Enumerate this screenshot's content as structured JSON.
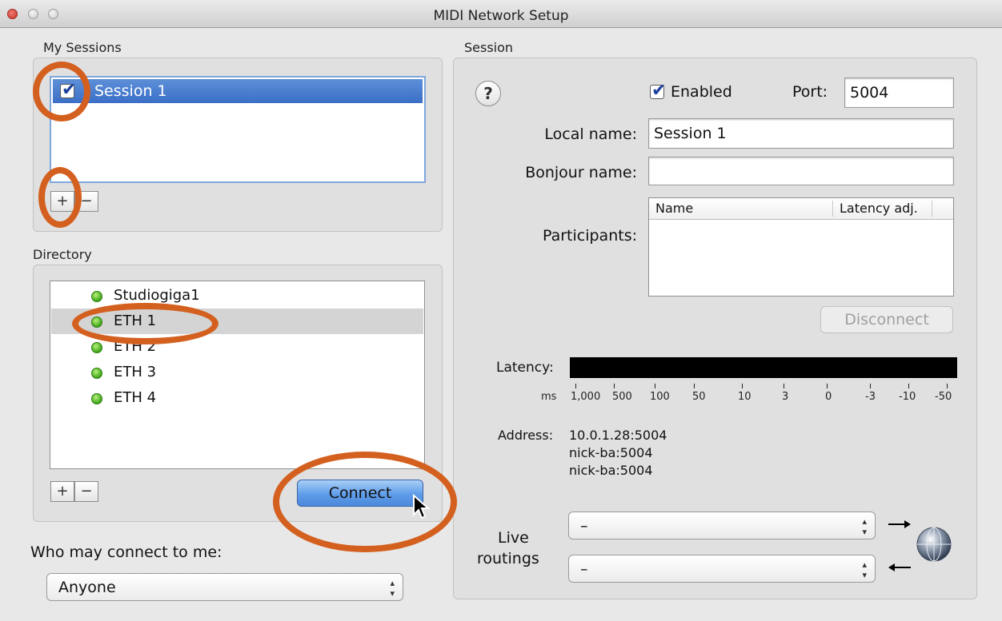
{
  "window": {
    "title": "MIDI Network Setup"
  },
  "my_sessions": {
    "label": "My Sessions",
    "items": [
      {
        "label": "Session 1",
        "checked": true
      }
    ],
    "add_label": "+",
    "remove_label": "−"
  },
  "directory": {
    "label": "Directory",
    "items": [
      {
        "label": "Studiogiga1"
      },
      {
        "label": "ETH 1"
      },
      {
        "label": "ETH 2"
      },
      {
        "label": "ETH 3"
      },
      {
        "label": "ETH 4"
      }
    ],
    "add_label": "+",
    "remove_label": "−",
    "connect_label": "Connect"
  },
  "who_may_connect": {
    "label": "Who may connect to me:",
    "value": "Anyone"
  },
  "session": {
    "label": "Session",
    "help_label": "?",
    "enabled_label": "Enabled",
    "port_label": "Port:",
    "port_value": "5004",
    "local_name_label": "Local name:",
    "local_name_value": "Session 1",
    "bonjour_name_label": "Bonjour name:",
    "bonjour_name_value": "",
    "participants_label": "Participants:",
    "participants_columns": [
      "Name",
      "Latency adj."
    ],
    "disconnect_label": "Disconnect",
    "latency_label": "Latency:",
    "ms_label": "ms",
    "latency_ticks": [
      "1,000",
      "500",
      "100",
      "50",
      "10",
      "3",
      "0",
      "-3",
      "-10",
      "-50"
    ],
    "address_label": "Address:",
    "addresses": [
      "10.0.1.28:5004",
      "nick-ba:5004",
      "nick-ba:5004"
    ],
    "live_routings_label_line1": "Live",
    "live_routings_label_line2": "routings",
    "routing_out_value": "–",
    "routing_in_value": "–"
  },
  "colors": {
    "selection": "#3a6fc7",
    "highlight": "#d4601f",
    "accent": "#5f9ce8"
  }
}
